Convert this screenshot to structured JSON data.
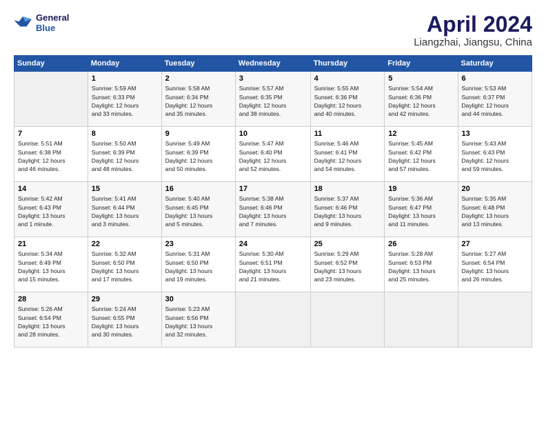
{
  "logo": {
    "line1": "General",
    "line2": "Blue"
  },
  "title": "April 2024",
  "location": "Liangzhai, Jiangsu, China",
  "days_header": [
    "Sunday",
    "Monday",
    "Tuesday",
    "Wednesday",
    "Thursday",
    "Friday",
    "Saturday"
  ],
  "weeks": [
    [
      {
        "day": "",
        "info": ""
      },
      {
        "day": "1",
        "info": "Sunrise: 5:59 AM\nSunset: 6:33 PM\nDaylight: 12 hours\nand 33 minutes."
      },
      {
        "day": "2",
        "info": "Sunrise: 5:58 AM\nSunset: 6:34 PM\nDaylight: 12 hours\nand 35 minutes."
      },
      {
        "day": "3",
        "info": "Sunrise: 5:57 AM\nSunset: 6:35 PM\nDaylight: 12 hours\nand 38 minutes."
      },
      {
        "day": "4",
        "info": "Sunrise: 5:55 AM\nSunset: 6:36 PM\nDaylight: 12 hours\nand 40 minutes."
      },
      {
        "day": "5",
        "info": "Sunrise: 5:54 AM\nSunset: 6:36 PM\nDaylight: 12 hours\nand 42 minutes."
      },
      {
        "day": "6",
        "info": "Sunrise: 5:53 AM\nSunset: 6:37 PM\nDaylight: 12 hours\nand 44 minutes."
      }
    ],
    [
      {
        "day": "7",
        "info": "Sunrise: 5:51 AM\nSunset: 6:38 PM\nDaylight: 12 hours\nand 46 minutes."
      },
      {
        "day": "8",
        "info": "Sunrise: 5:50 AM\nSunset: 6:39 PM\nDaylight: 12 hours\nand 48 minutes."
      },
      {
        "day": "9",
        "info": "Sunrise: 5:49 AM\nSunset: 6:39 PM\nDaylight: 12 hours\nand 50 minutes."
      },
      {
        "day": "10",
        "info": "Sunrise: 5:47 AM\nSunset: 6:40 PM\nDaylight: 12 hours\nand 52 minutes."
      },
      {
        "day": "11",
        "info": "Sunrise: 5:46 AM\nSunset: 6:41 PM\nDaylight: 12 hours\nand 54 minutes."
      },
      {
        "day": "12",
        "info": "Sunrise: 5:45 AM\nSunset: 6:42 PM\nDaylight: 12 hours\nand 57 minutes."
      },
      {
        "day": "13",
        "info": "Sunrise: 5:43 AM\nSunset: 6:43 PM\nDaylight: 12 hours\nand 59 minutes."
      }
    ],
    [
      {
        "day": "14",
        "info": "Sunrise: 5:42 AM\nSunset: 6:43 PM\nDaylight: 13 hours\nand 1 minute."
      },
      {
        "day": "15",
        "info": "Sunrise: 5:41 AM\nSunset: 6:44 PM\nDaylight: 13 hours\nand 3 minutes."
      },
      {
        "day": "16",
        "info": "Sunrise: 5:40 AM\nSunset: 6:45 PM\nDaylight: 13 hours\nand 5 minutes."
      },
      {
        "day": "17",
        "info": "Sunrise: 5:38 AM\nSunset: 6:46 PM\nDaylight: 13 hours\nand 7 minutes."
      },
      {
        "day": "18",
        "info": "Sunrise: 5:37 AM\nSunset: 6:46 PM\nDaylight: 13 hours\nand 9 minutes."
      },
      {
        "day": "19",
        "info": "Sunrise: 5:36 AM\nSunset: 6:47 PM\nDaylight: 13 hours\nand 11 minutes."
      },
      {
        "day": "20",
        "info": "Sunrise: 5:35 AM\nSunset: 6:48 PM\nDaylight: 13 hours\nand 13 minutes."
      }
    ],
    [
      {
        "day": "21",
        "info": "Sunrise: 5:34 AM\nSunset: 6:49 PM\nDaylight: 13 hours\nand 15 minutes."
      },
      {
        "day": "22",
        "info": "Sunrise: 5:32 AM\nSunset: 6:50 PM\nDaylight: 13 hours\nand 17 minutes."
      },
      {
        "day": "23",
        "info": "Sunrise: 5:31 AM\nSunset: 6:50 PM\nDaylight: 13 hours\nand 19 minutes."
      },
      {
        "day": "24",
        "info": "Sunrise: 5:30 AM\nSunset: 6:51 PM\nDaylight: 13 hours\nand 21 minutes."
      },
      {
        "day": "25",
        "info": "Sunrise: 5:29 AM\nSunset: 6:52 PM\nDaylight: 13 hours\nand 23 minutes."
      },
      {
        "day": "26",
        "info": "Sunrise: 5:28 AM\nSunset: 6:53 PM\nDaylight: 13 hours\nand 25 minutes."
      },
      {
        "day": "27",
        "info": "Sunrise: 5:27 AM\nSunset: 6:54 PM\nDaylight: 13 hours\nand 26 minutes."
      }
    ],
    [
      {
        "day": "28",
        "info": "Sunrise: 5:26 AM\nSunset: 6:54 PM\nDaylight: 13 hours\nand 28 minutes."
      },
      {
        "day": "29",
        "info": "Sunrise: 5:24 AM\nSunset: 6:55 PM\nDaylight: 13 hours\nand 30 minutes."
      },
      {
        "day": "30",
        "info": "Sunrise: 5:23 AM\nSunset: 6:56 PM\nDaylight: 13 hours\nand 32 minutes."
      },
      {
        "day": "",
        "info": ""
      },
      {
        "day": "",
        "info": ""
      },
      {
        "day": "",
        "info": ""
      },
      {
        "day": "",
        "info": ""
      }
    ]
  ]
}
